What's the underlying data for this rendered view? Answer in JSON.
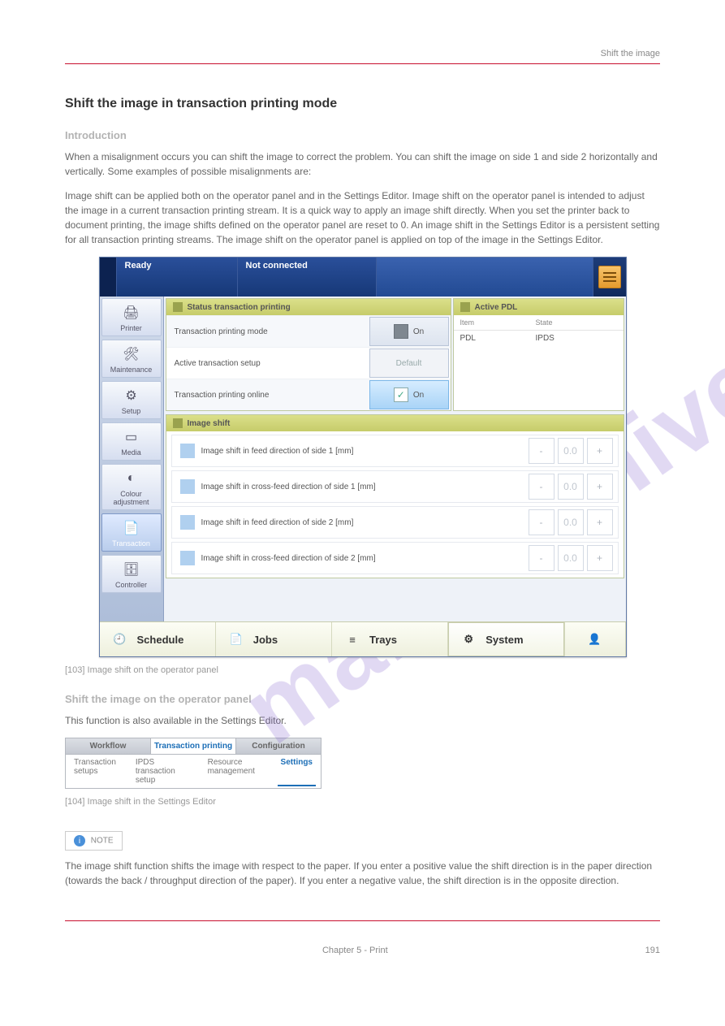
{
  "header": {
    "left": " ",
    "right": "Shift the image"
  },
  "watermark": "manualshive.com",
  "intro": {
    "title": "Shift the image in transaction printing mode",
    "sub": "Introduction",
    "text1": "When a misalignment occurs you can shift the image to correct the problem. You can shift the image on side 1 and side 2 horizontally and vertically. Some examples of possible misalignments are:",
    "text2": "Image shift can be applied both on the operator panel and in the Settings Editor. Image shift on the operator panel is intended to adjust the image in a current transaction printing stream. It is a quick way to apply an image shift directly. When you set the printer back to document printing, the image shifts defined on the operator panel are reset to 0. An image shift in the Settings Editor is a persistent setting for all transaction printing streams. The image shift on the operator panel is applied on top of the image in the Settings Editor."
  },
  "screenshot1": {
    "topbar": {
      "ready": "Ready",
      "conn": "Not connected"
    },
    "sidebar": [
      "Printer",
      "Maintenance",
      "Setup",
      "Media",
      "Colour adjustment",
      "Transaction",
      "Controller"
    ],
    "sidebar_active_index": 5,
    "status_panel": {
      "title": "Status transaction printing",
      "rows": [
        {
          "label": "Transaction printing mode",
          "value": "On",
          "style": "gray"
        },
        {
          "label": "Active transaction setup",
          "value": "Default",
          "style": "plain"
        },
        {
          "label": "Transaction printing online",
          "value": "On",
          "style": "on"
        }
      ]
    },
    "pdl_panel": {
      "title": "Active PDL",
      "head": [
        "Item",
        "State"
      ],
      "row": [
        "PDL",
        "IPDS"
      ]
    },
    "image_shift": {
      "title": "Image shift",
      "rows": [
        "Image shift in feed direction of side 1 [mm]",
        "Image shift in cross-feed direction of side 1 [mm]",
        "Image shift in feed direction of side 2 [mm]",
        "Image shift in cross-feed direction of side 2 [mm]"
      ],
      "value": "0.0",
      "minus": "-",
      "plus": "+"
    },
    "bottombar": {
      "tabs": [
        "Schedule",
        "Jobs",
        "Trays",
        "System"
      ],
      "active_index": 3
    }
  },
  "caption1": "[103] Image shift on the operator panel",
  "below_title": "Shift the image on the operator panel",
  "refer": "This function is also available in the Settings Editor.",
  "screenshot2": {
    "tabs": [
      "Workflow",
      "Transaction printing",
      "Configuration"
    ],
    "active_index": 1,
    "subtabs": [
      "Transaction setups",
      "IPDS transaction setup",
      "Resource management",
      "Settings"
    ],
    "sub_active_index": 3
  },
  "caption2": "[104] Image shift in the Settings Editor",
  "note_title": "NOTE",
  "note_text": "The image shift function shifts the image with respect to the paper. If you enter a positive value the shift direction is in the paper direction (towards the back / throughput direction of the paper). If you enter a negative value, the shift direction is in the opposite direction.",
  "footer": {
    "left": " ",
    "center": "Chapter 5 - Print",
    "right": "191"
  }
}
